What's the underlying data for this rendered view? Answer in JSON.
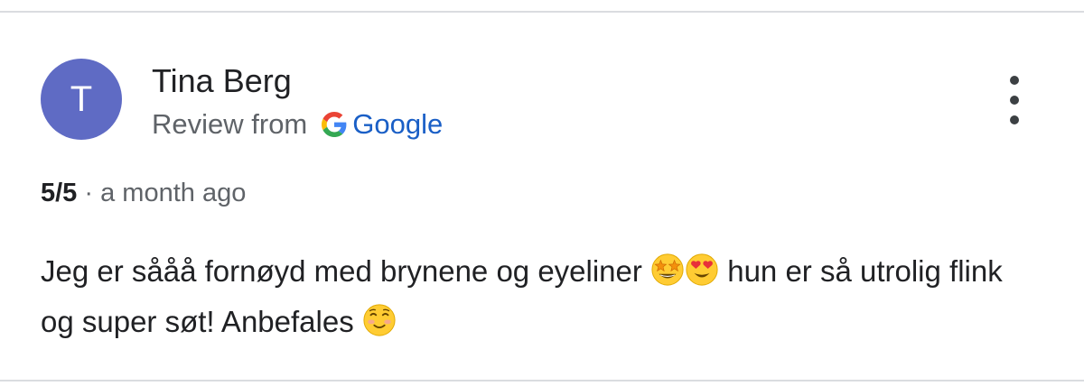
{
  "review": {
    "avatar_letter": "T",
    "author_name": "Tina Berg",
    "source_prefix": "Review from",
    "source_name": "Google",
    "rating": "5/5",
    "separator": " · ",
    "time_ago": "a month ago",
    "text_part1": "Jeg er sååå fornøyd med brynene og eyeliner ",
    "text_part2": " hun er så utrolig flink og super søt! Anbefales ",
    "emojis": [
      "star-struck-emoji",
      "heart-eyes-emoji",
      "smiling-blush-emoji"
    ]
  },
  "colors": {
    "avatar_bg": "#5f6bc4",
    "google_blue": "#1a5fc6",
    "secondary_text": "#5f6368",
    "primary_text": "#202124",
    "divider": "#dadce0"
  },
  "icons": {
    "menu": "more-vertical-icon",
    "google": "google-g-logo-icon"
  }
}
